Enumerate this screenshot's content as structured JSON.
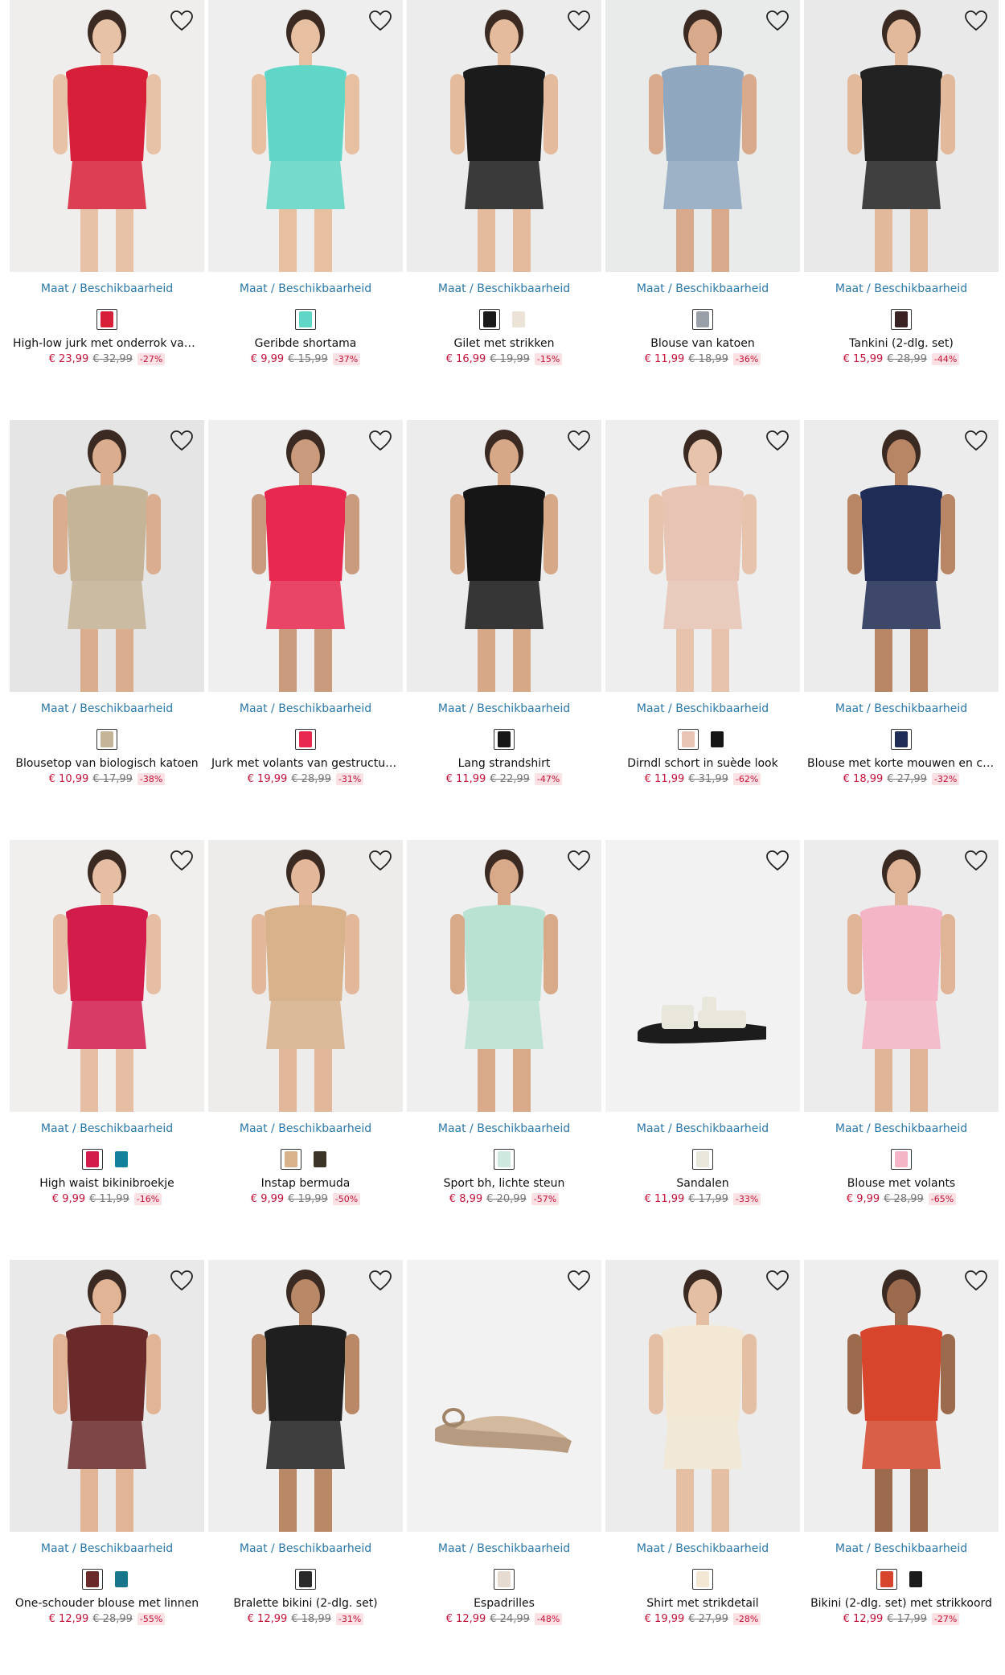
{
  "size_link_label": "Maat / Beschikbaarheid",
  "products": [
    {
      "name": "High-low jurk met onderrok van tule",
      "price": "€ 23,99",
      "old_price": "€ 32,99",
      "discount": "-27%",
      "bg": "#f0eeec",
      "garment": "#d81f3a",
      "skin": "#e8c2a6",
      "swatches": [
        "#d81f3a"
      ]
    },
    {
      "name": "Geribde shortama",
      "price": "€ 9,99",
      "old_price": "€ 15,99",
      "discount": "-37%",
      "bg": "#eeeeee",
      "garment": "#5fd6c6",
      "skin": "#e7bfa1",
      "swatches": [
        "#5fd6c6"
      ]
    },
    {
      "name": "Gilet met strikken",
      "price": "€ 16,99",
      "old_price": "€ 19,99",
      "discount": "-15%",
      "bg": "#ececec",
      "garment": "#1b1b1b",
      "skin": "#e4bb9c",
      "swatches": [
        "#1b1b1b",
        "#ebe3d6"
      ]
    },
    {
      "name": "Blouse van katoen",
      "price": "€ 11,99",
      "old_price": "€ 18,99",
      "discount": "-36%",
      "bg": "#e9eaea",
      "garment": "#8fa8bf",
      "skin": "#d8a98a",
      "swatches": [
        "#9aa0a8"
      ]
    },
    {
      "name": "Tankini (2-dlg. set)",
      "price": "€ 15,99",
      "old_price": "€ 28,99",
      "discount": "-44%",
      "bg": "#e9e9e9",
      "garment": "#222222",
      "skin": "#e2b99a",
      "swatches": [
        "#3a2222"
      ]
    },
    {
      "name": "Blousetop van biologisch katoen",
      "price": "€ 10,99",
      "old_price": "€ 17,99",
      "discount": "-38%",
      "bg": "#e5e5e5",
      "garment": "#c5b497",
      "skin": "#d9ad8e",
      "swatches": [
        "#c5b497"
      ]
    },
    {
      "name": "Jurk met volants van gestructureerd materiaal",
      "price": "€ 19,99",
      "old_price": "€ 28,99",
      "discount": "-31%",
      "bg": "#efefef",
      "garment": "#e8284f",
      "skin": "#c99a7b",
      "swatches": [
        "#e8284f"
      ]
    },
    {
      "name": "Lang strandshirt",
      "price": "€ 11,99",
      "old_price": "€ 22,99",
      "discount": "-47%",
      "bg": "#ececec",
      "garment": "#161616",
      "skin": "#d6a888",
      "swatches": [
        "#161616"
      ]
    },
    {
      "name": "Dirndl schort in suède look",
      "price": "€ 11,99",
      "old_price": "€ 31,99",
      "discount": "-62%",
      "bg": "#eeeeee",
      "garment": "#e8c4b4",
      "skin": "#e6c3aa",
      "swatches": [
        "#e8c4b4",
        "#161616"
      ]
    },
    {
      "name": "Blouse met korte mouwen en ceintuur",
      "price": "€ 18,99",
      "old_price": "€ 27,99",
      "discount": "-32%",
      "bg": "#ececec",
      "garment": "#1f2c55",
      "skin": "#b88565",
      "swatches": [
        "#1f2c55"
      ]
    },
    {
      "name": "High waist bikinibroekje",
      "price": "€ 9,99",
      "old_price": "€ 11,99",
      "discount": "-16%",
      "bg": "#f1efee",
      "garment": "#d31b4c",
      "skin": "#e6bea4",
      "swatches": [
        "#d31b4c",
        "#12819b"
      ]
    },
    {
      "name": "Instap bermuda",
      "price": "€ 9,99",
      "old_price": "€ 19,99",
      "discount": "-50%",
      "bg": "#eeeceb",
      "garment": "#d7b28b",
      "skin": "#e2b79a",
      "swatches": [
        "#d7b28b",
        "#3d3428"
      ]
    },
    {
      "name": "Sport bh, lichte steun",
      "price": "€ 8,99",
      "old_price": "€ 20,99",
      "discount": "-57%",
      "bg": "#efefef",
      "garment": "#b9e2d2",
      "skin": "#d9aa8a",
      "swatches": [
        "#cde9df"
      ]
    },
    {
      "name": "Sandalen",
      "price": "€ 11,99",
      "old_price": "€ 17,99",
      "discount": "-33%",
      "bg": "#f2f2f2",
      "garment": "#e9e6dc",
      "skin": "#222222",
      "swatches": [
        "#e9e6dc"
      ]
    },
    {
      "name": "Blouse met volants",
      "price": "€ 9,99",
      "old_price": "€ 28,99",
      "discount": "-65%",
      "bg": "#ececec",
      "garment": "#f4b5c6",
      "skin": "#e0b597",
      "swatches": [
        "#f4b5c6"
      ]
    },
    {
      "name": "One-schouder blouse met linnen",
      "price": "€ 12,99",
      "old_price": "€ 28,99",
      "discount": "-55%",
      "bg": "#e9e9e9",
      "garment": "#6a2a2a",
      "skin": "#e0b495",
      "swatches": [
        "#6a2a2a",
        "#17768b"
      ]
    },
    {
      "name": "Bralette bikini (2-dlg. set)",
      "price": "€ 12,99",
      "old_price": "€ 18,99",
      "discount": "-31%",
      "bg": "#eeeeee",
      "garment": "#1f1f1f",
      "skin": "#b98867",
      "swatches": [
        "#2a2a2a"
      ]
    },
    {
      "name": "Espadrilles",
      "price": "€ 12,99",
      "old_price": "€ 24,99",
      "discount": "-48%",
      "bg": "#f2f2f2",
      "garment": "#d3b99d",
      "skin": "#d3b99d",
      "swatches": [
        "#e5dbd0"
      ]
    },
    {
      "name": "Shirt met strikdetail",
      "price": "€ 19,99",
      "old_price": "€ 27,99",
      "discount": "-28%",
      "bg": "#ececec",
      "garment": "#f2e8d4",
      "skin": "#e5bfa3",
      "swatches": [
        "#f2e8d4"
      ]
    },
    {
      "name": "Bikini (2-dlg. set) met strikkoord",
      "price": "€ 12,99",
      "old_price": "€ 17,99",
      "discount": "-27%",
      "bg": "#eeeeee",
      "garment": "#d6452c",
      "skin": "#9c6a4c",
      "swatches": [
        "#d6452c",
        "#1b1b1b"
      ]
    }
  ]
}
